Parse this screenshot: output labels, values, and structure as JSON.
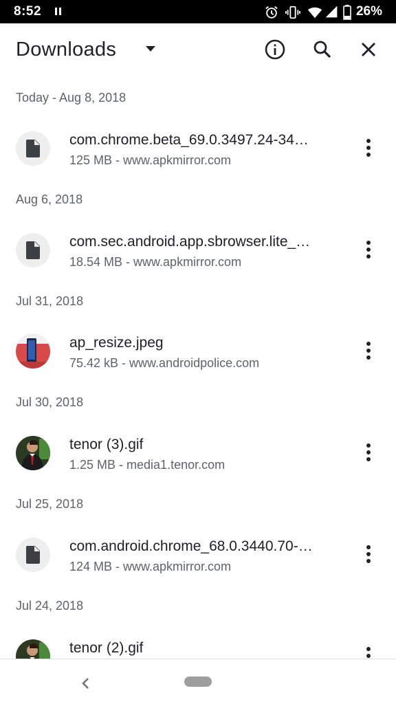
{
  "status_bar": {
    "time": "8:52",
    "battery": "26%",
    "icons": [
      "pause-icon",
      "alarm-icon",
      "vibrate-icon",
      "wifi-icon",
      "signal-icon",
      "battery-icon"
    ]
  },
  "app_bar": {
    "title": "Downloads",
    "icons": [
      "dropdown-arrow-icon",
      "info-icon",
      "search-icon",
      "close-icon"
    ]
  },
  "groups": [
    {
      "date": "Today - Aug 8, 2018",
      "item": {
        "name": "com.chrome.beta_69.0.3497.24-34…",
        "meta": "125 MB - www.apkmirror.com",
        "thumb": "file-icon"
      }
    },
    {
      "date": "Aug 6, 2018",
      "item": {
        "name": "com.sec.android.app.sbrowser.lite_…",
        "meta": "18.54 MB - www.apkmirror.com",
        "thumb": "file-icon"
      }
    },
    {
      "date": "Jul 31, 2018",
      "item": {
        "name": "ap_resize.jpeg",
        "meta": "75.42 kB - www.androidpolice.com",
        "thumb": "image-thumbnail"
      }
    },
    {
      "date": "Jul 30, 2018",
      "item": {
        "name": "tenor (3).gif",
        "meta": "1.25 MB - media1.tenor.com",
        "thumb": "image-thumbnail"
      }
    },
    {
      "date": "Jul 25, 2018",
      "item": {
        "name": "com.android.chrome_68.0.3440.70-…",
        "meta": "124 MB - www.apkmirror.com",
        "thumb": "file-icon"
      }
    },
    {
      "date": "Jul 24, 2018",
      "item": {
        "name": "tenor (2).gif",
        "meta": "",
        "thumb": "image-thumbnail"
      }
    }
  ],
  "nav_bar": {
    "icons": [
      "back-icon",
      "home-pill"
    ]
  },
  "colors": {
    "status_bar_bg": "#000000",
    "primary_text": "#202124",
    "secondary_text": "#5f6368",
    "thumb_bg": "#eeeeee"
  }
}
